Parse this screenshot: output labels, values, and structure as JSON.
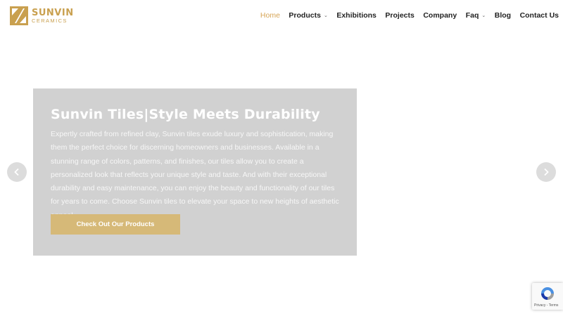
{
  "brand": {
    "name": "SUNVIN",
    "sub": "CERAMICS",
    "color": "#c9a04f"
  },
  "nav": {
    "items": [
      {
        "label": "Home",
        "active": true
      },
      {
        "label": "Products",
        "dropdown": true
      },
      {
        "label": "Exhibitions"
      },
      {
        "label": "Projects"
      },
      {
        "label": "Company"
      },
      {
        "label": "Faq",
        "dropdown": true
      },
      {
        "label": "Blog"
      },
      {
        "label": "Contact Us"
      }
    ],
    "active_color": "#d6a556"
  },
  "hero": {
    "title": "Sunvin Tiles|Style Meets Durability",
    "description": "Expertly crafted from refined clay, Sunvin tiles exude luxury and sophistication, making them the perfect choice for discerning homeowners and businesses. Available in a stunning range of colors, patterns, and finishes, our tiles allow you to create a personalized look that reflects your unique style and taste. And with their exceptional durability and easy maintenance, you can enjoy the beauty and functionality of our tiles for years to come. Choose Sunvin tiles to elevate your space to new heights of aesthetic appeal.",
    "button_label": "Check Out Our Products",
    "button_color": "#d6b978",
    "panel_color": "#d1d1d1"
  },
  "slider": {
    "prev_icon": "chevron-left-icon",
    "next_icon": "chevron-right-icon"
  },
  "recaptcha": {
    "icon": "recaptcha-icon",
    "links": "Privacy - Terms"
  }
}
